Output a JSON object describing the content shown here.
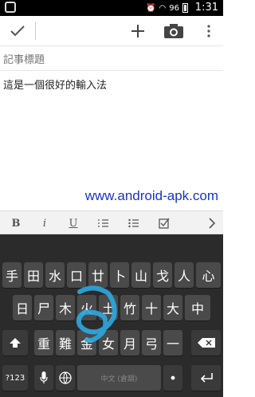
{
  "status_bar": {
    "battery": "96",
    "time": "1:31"
  },
  "action_bar": {
    "done_icon": "check-icon",
    "add_icon": "plus-icon",
    "camera_icon": "camera-icon",
    "more_icon": "overflow-icon"
  },
  "note": {
    "title_placeholder": "記事標題",
    "body": "這是一個很好的輸入法"
  },
  "watermark": "www.android-apk.com",
  "format_bar": {
    "bold": "B",
    "italic": "i",
    "underline": "U"
  },
  "keyboard": {
    "row1": [
      "手",
      "田",
      "水",
      "口",
      "廿",
      "卜",
      "山",
      "戈",
      "人",
      "心"
    ],
    "row2": [
      "日",
      "尸",
      "木",
      "火",
      "土",
      "竹",
      "十",
      "大",
      "中"
    ],
    "row3": [
      "重",
      "難",
      "金",
      "女",
      "月",
      "弓",
      "一"
    ],
    "symbols_key": "?123",
    "space_label": "中文 (倉頡)",
    "swipe_color": "#2ea8e0"
  }
}
